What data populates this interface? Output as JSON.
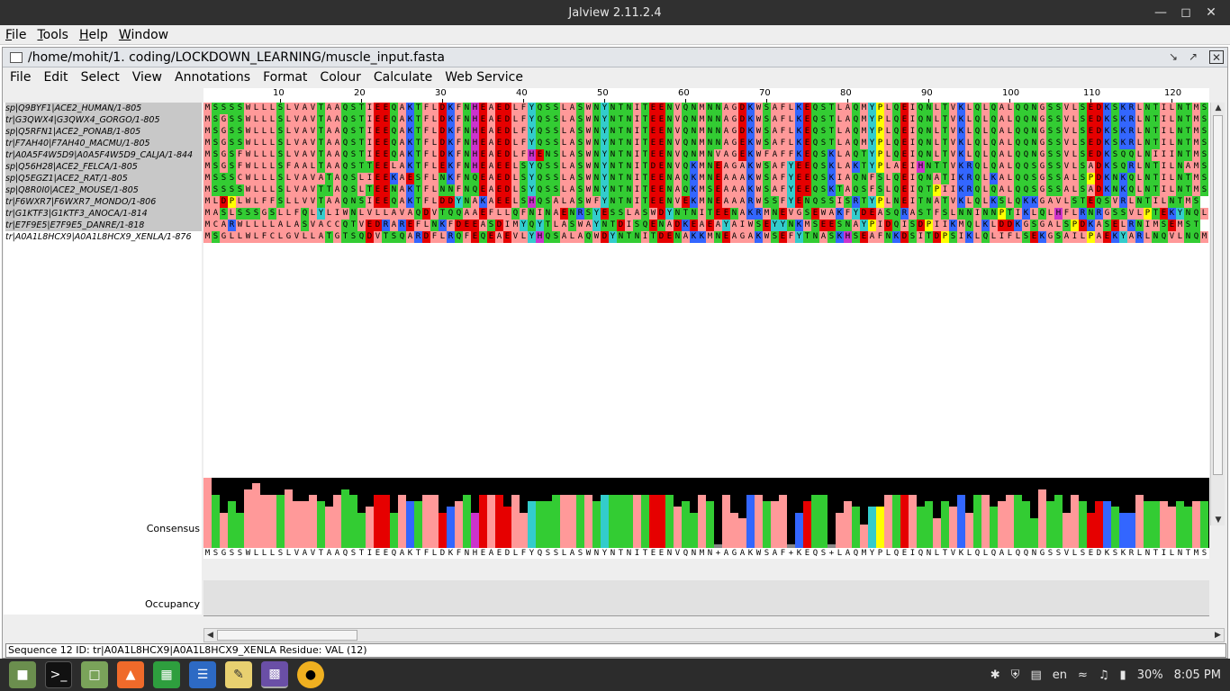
{
  "window": {
    "title": "Jalview 2.11.2.4"
  },
  "menubar": {
    "items": [
      "File",
      "Tools",
      "Help",
      "Window"
    ]
  },
  "alignment_window": {
    "title": "/home/mohit/1. coding/LOCKDOWN_LEARNING/muscle_input.fasta",
    "menu": [
      "File",
      "Edit",
      "Select",
      "View",
      "Annotations",
      "Format",
      "Colour",
      "Calculate",
      "Web Service"
    ]
  },
  "ruler": {
    "ticks": [
      "10",
      "20",
      "30",
      "40",
      "50",
      "60",
      "70",
      "80",
      "90",
      "100",
      "110",
      "120"
    ]
  },
  "sequences": [
    {
      "name": "sp|Q9BYF1|ACE2_HUMAN/1-805",
      "seq": "MSSSSWLLLSLVAVTAAQSTIEEQAKTFLDKFNHEAEDLFYQSSLASWNYNTNITEENVQNMNNAGDKWSAFLKEQSTLAQMYPLQEIQNLTVKLQLQALQQNGSSVLSEDKSKRLNTILNTMS"
    },
    {
      "name": "tr|G3QWX4|G3QWX4_GORGO/1-805",
      "seq": "MSGSSWLLLSLVAVTAAQSTIEEQAKTFLDKFNHEAEDLFYQSSLASWNYNTNITEENVQNMNNAGDKWSAFLKEQSTLAQMYPLQEIQNLTVKLQLQALQQNGSSVLSEDKSKRLNTILNTMS"
    },
    {
      "name": "sp|Q5RFN1|ACE2_PONAB/1-805",
      "seq": "MSGSSWLLLSLVAVTAAQSTIEEQAKTFLDKFNHEAEDLFYQSSLASWNYNTNITEENVQNMNNAGDKWSAFLKEQSTLAQMYPLQEIQNLTVKLQLQALQQNGSSVLSEDKSKRLNTILNTMS"
    },
    {
      "name": "tr|F7AH40|F7AH40_MACMU/1-805",
      "seq": "MSGSSWLLLSLVAVTAAQSTIEEQAKTFLDKFNHEAEDLFYQSSLASWNYNTNITEENVQNMNNAGEKWSAFLKEQSTLAQMYPLQEIQNLTVKLQLQALQQNGSSVLSEDKSKRLNTILNTMS"
    },
    {
      "name": "tr|A0A5F4W5D9|A0A5F4W5D9_CALJA/1-844",
      "seq": "MSGSFWLLLSLVAVTAAQSTIEEQAKTFLDKFNHEAEDLFHENSLASWNYNTNITEENVQNMNVAGEKWFAFFKEQSKLAQTYPLQEIQNLTVKLQLQALQQNGSSVLSEDKSQQLNIIINTMS"
    },
    {
      "name": "sp|Q56H28|ACE2_FELCA/1-805",
      "seq": "MSGSFWLLLSFAALTAAQSTTEELAKTFLEKFNHEAEELSYQSSLASWNYNTNITDENVQKMNEAGAKWSAFYEEQSKLAKTYPLAEIHNTTVKRQLQALQQSGSSVLSADKSQRLNTILNAMS"
    },
    {
      "name": "sp|Q5EGZ1|ACE2_RAT/1-805",
      "seq": "MSSSCWLLLSLVAVATAQSLIEEKAESFLNKFNQEAEDLSYQSSLASWNYNTNITEENAQKMNEAAAKWSAFYEEQSKIAQNFSLQEIQNATIKRQLKALQQSGSSALSPDKNKQLNTILNTMS"
    },
    {
      "name": "sp|Q8R0I0|ACE2_MOUSE/1-805",
      "seq": "MSSSSWLLLSLVAVTTAQSLTEENAKTFLNNFNQEAEDLSYQSSLASWNYNTNITEENAQKMSEAAAKWSAFYEEQSKTAQSFSLQEIQTPIIKRQLQALQQSGSSALSADKNKQLNTILNTMS"
    },
    {
      "name": "tr|F6WXR7|F6WXR7_MONDO/1-806",
      "seq": "MLDPLWLFFSLLVVTAAQNSIEEQAKTFLDDYNAKAEELSHQSALASWFYNTNITEENVEKMNEAAARWSSFYENQSSISRTYPLNEITNATVKLQLKSLQKKGAVLSTEQSVRLNTILNTMS"
    },
    {
      "name": "tr|G1KTF3|G1KTF3_ANOCA/1-814",
      "seq": "MASLSSSGSLLFQLYLIWNLVLLAVAQDVTQQAAEFLLQFNINAENRSYESSLASWDYNTNITEENAKRMNEVGSEWAKFYDEASQRASTFSLNNINNPTIKLQLHFLRNRGSSVLPTEKYNQL"
    },
    {
      "name": "tr|E7F9E5|E7F9E5_DANRE/1-818",
      "seq": "MCARWLLLLALASVACCQTVEDRAREFLNKFDEEASDIMYQYTLASWAYNTDISQENADKEAEAYAIWSEYYNKMSEESNAYPIDQISDPIIKMQLKLDDKGSGALSPDKASELRNIMSEMST"
    },
    {
      "name": "tr|A0A1L8HCX9|A0A1L8HCX9_XENLA/1-876",
      "seq": "MSGLLWLFCLGVLLATGTSQDVTSQARDFLRQFEQEAEVLYHQSALAQWDYNTNITDENAKKMNEAGAKWSEFYTNASKHSEAFNKDSITDPSIKLQLIFLSEKGSAILPAEKYARLNQVLNQM"
    }
  ],
  "annotations": {
    "consensus_label": "Consensus",
    "occupancy_label": "Occupancy",
    "consensus_sequence": "MSGSSWLLLSLVAVTAAQSTIEEQAKTFLDKFNHEAEDLFYQSSLASWNYNTNITEENVQNMN+AGAKWSAF+KEQS+LAQMYPLQEIQNLTVKLQLQALQQNGSSVLSEDKSKRLNTILNTMS"
  },
  "colors": {
    "A": "#ff9999",
    "L": "#ff9999",
    "I": "#ff9999",
    "V": "#ff9999",
    "M": "#ff9999",
    "F": "#ff9999",
    "W": "#ff9999",
    "G": "#ff9999",
    "P": "#ffff00",
    "C": "#ff9999",
    "S": "#33cc33",
    "T": "#33cc33",
    "N": "#33cc33",
    "Q": "#33cc33",
    "D": "#e60000",
    "E": "#e60000",
    "K": "#3366ff",
    "R": "#3366ff",
    "H": "#cc33cc",
    "Y": "#33cccc"
  },
  "status": {
    "text": "Sequence 12 ID: tr|A0A1L8HCX9|A0A1L8HCX9_XENLA Residue: VAL (12)"
  },
  "tray": {
    "lang": "en",
    "battery": "30%",
    "time": "8:05 PM"
  }
}
